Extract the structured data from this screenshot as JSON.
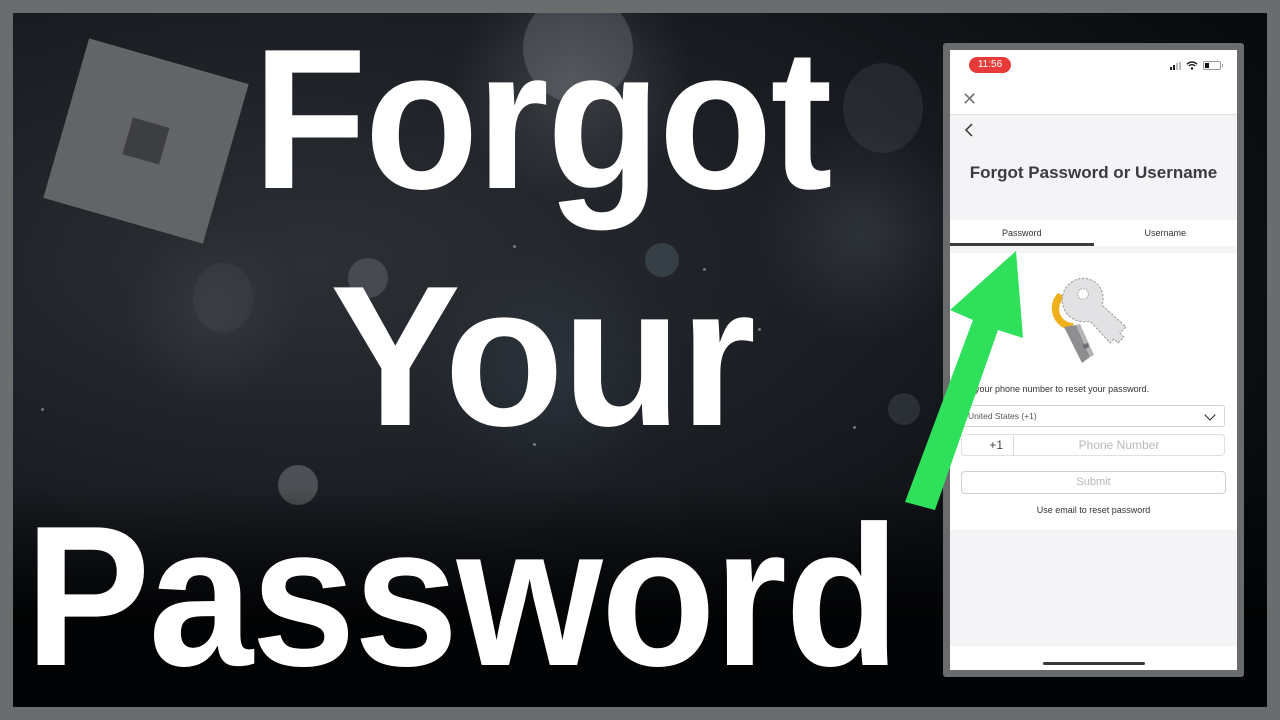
{
  "headline": {
    "line1": "Forgot",
    "line2": "Your",
    "line3": "Password"
  },
  "logo": {
    "icon": "roblox-logo-icon"
  },
  "colors": {
    "arrow": "#2ee05a",
    "status_pill": "#e93a3a",
    "frame": "#6b6c6e"
  },
  "phone": {
    "status_bar": {
      "time": "11:56",
      "icons": [
        "signal-icon",
        "wifi-icon",
        "battery-icon"
      ]
    },
    "close_icon": "✕",
    "back_icon": "‹",
    "title": "Forgot Password or Username",
    "tabs": [
      {
        "label": "Password",
        "active": true
      },
      {
        "label": "Username",
        "active": false
      }
    ],
    "illustration": "keys-icon",
    "instruction": "ter your phone number to reset your password.",
    "country_select": {
      "value": "United States (+1)"
    },
    "phone_field": {
      "dial_code": "+1",
      "placeholder": "Phone Number",
      "value": ""
    },
    "submit_label": "Submit",
    "email_link": "Use email to reset password"
  }
}
